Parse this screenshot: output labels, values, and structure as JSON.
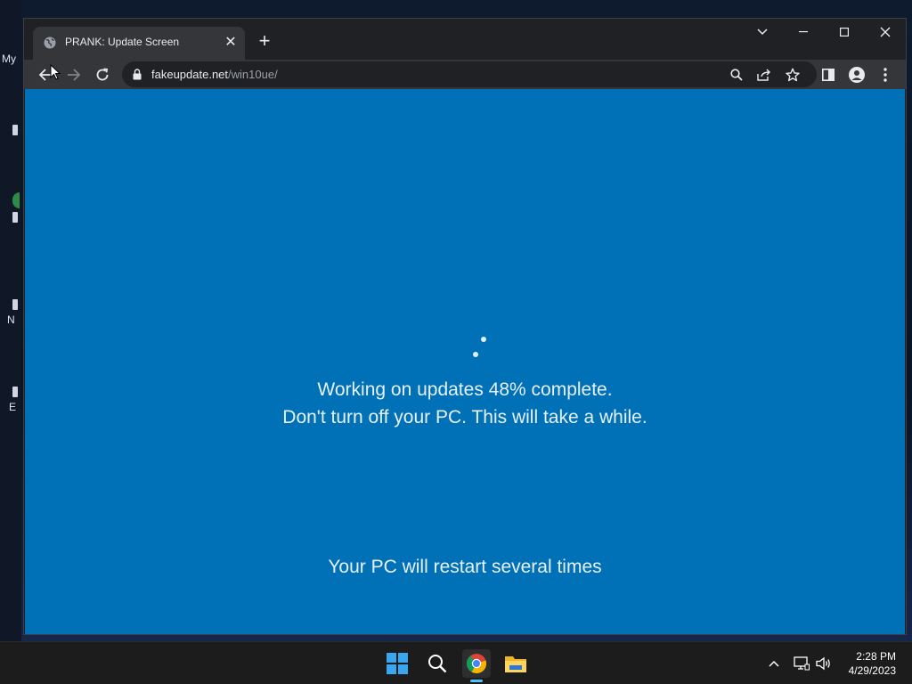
{
  "desktop": {
    "labels": [
      "My",
      "N",
      "E"
    ]
  },
  "browser": {
    "tab_title": "PRANK: Update Screen",
    "tab_favicon": "globe-icon",
    "url_host": "fakeupdate.net",
    "url_path": "/win10ue/"
  },
  "update_screen": {
    "line1": "Working on updates  48% complete.",
    "line2": "Don't turn off your PC. This will take a while.",
    "line3": "Your PC will restart several times",
    "percent_complete": 48,
    "background_color": "#0070b7"
  },
  "taskbar": {
    "apps": [
      "windows-start-icon",
      "search-icon",
      "chrome-icon",
      "file-explorer-icon"
    ],
    "active_app": "chrome-icon",
    "time": "2:28 PM",
    "date": "4/29/2023"
  }
}
